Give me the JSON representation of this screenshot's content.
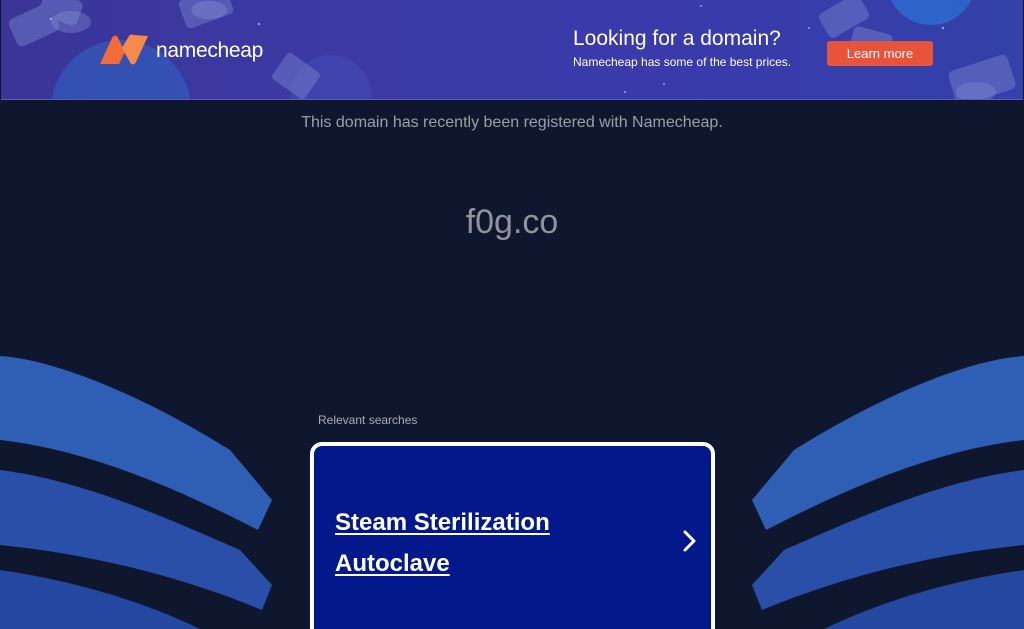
{
  "banner": {
    "logo_text": "namecheap",
    "title": "Looking for a domain?",
    "subtitle": "Namecheap has some of the best prices.",
    "cta_label": "Learn more",
    "logo_color": "#f26b38",
    "cta_color": "#e8533c"
  },
  "main": {
    "registered_message": "This domain has recently been registered with Namecheap.",
    "domain": "f0g.co"
  },
  "searches": {
    "label": "Relevant searches",
    "items": [
      {
        "label": "Steam Sterilization Autoclave",
        "icon": "chevron-right-icon"
      }
    ]
  },
  "colors": {
    "background": "#0f172e",
    "card": "#03188a",
    "wave_light": "#2f5fb5",
    "wave_mid": "#2a4fa8"
  }
}
